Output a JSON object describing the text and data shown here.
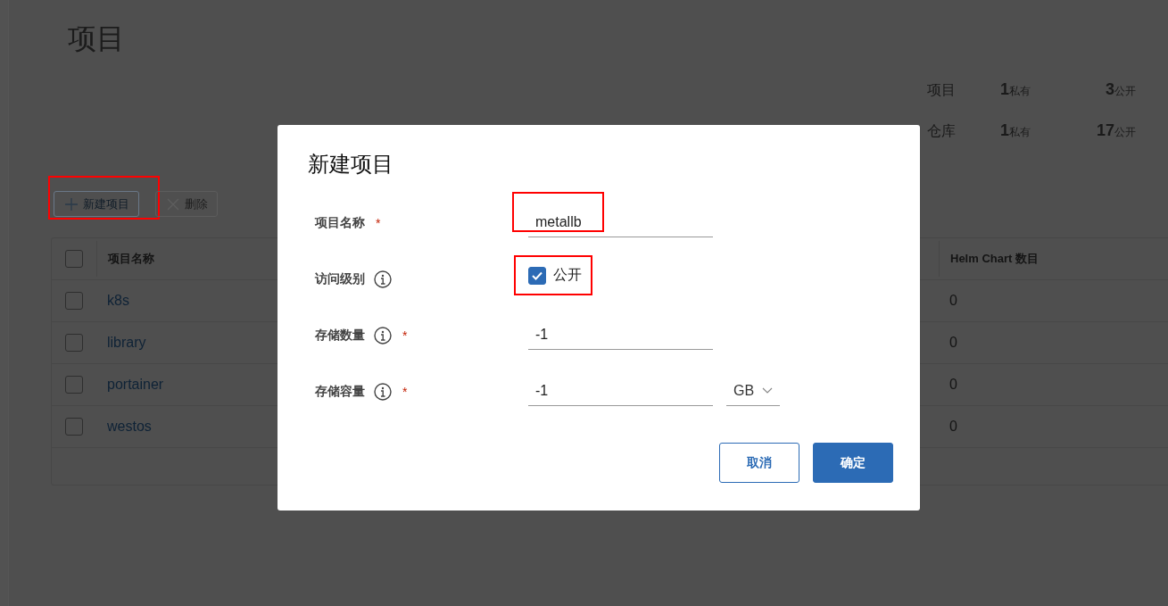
{
  "page": {
    "title": "项目",
    "stats": [
      {
        "label": "项目",
        "private_count": "1",
        "private_label": "私有",
        "public_count": "3",
        "public_label": "公开"
      },
      {
        "label": "仓库",
        "private_count": "1",
        "private_label": "私有",
        "public_count": "17",
        "public_label": "公开"
      }
    ],
    "toolbar": [
      {
        "label": "新建项目",
        "disabled": false,
        "highlighted": true
      },
      {
        "label": "删除",
        "disabled": true,
        "highlighted": false
      }
    ],
    "table": {
      "all_selected": false,
      "columns": [
        "项目名称",
        "Helm Chart 数目"
      ],
      "rows": [
        {
          "name": "k8s",
          "helm_charts": "0",
          "selected": false
        },
        {
          "name": "library",
          "helm_charts": "0",
          "selected": false
        },
        {
          "name": "portainer",
          "helm_charts": "0",
          "selected": false
        },
        {
          "name": "westos",
          "helm_charts": "0",
          "selected": false
        }
      ]
    }
  },
  "dialog": {
    "title": "新建项目",
    "fields": [
      {
        "kind": "text",
        "label": "项目名称",
        "info": false,
        "required_mark": "*",
        "value": "metallb",
        "highlighted": true
      },
      {
        "kind": "checkbox",
        "label": "访问级别",
        "info": true,
        "option": "公开",
        "checked": true,
        "highlighted": true
      },
      {
        "kind": "text",
        "label": "存储数量",
        "info": true,
        "required_mark": "*",
        "value": "-1",
        "highlighted": false
      },
      {
        "kind": "text_unit",
        "label": "存储容量",
        "info": true,
        "required_mark": "*",
        "value": "-1",
        "unit": "GB",
        "highlighted": false
      }
    ],
    "buttons": [
      {
        "label": "取消",
        "primary": false
      },
      {
        "label": "确定",
        "primary": true
      }
    ]
  }
}
